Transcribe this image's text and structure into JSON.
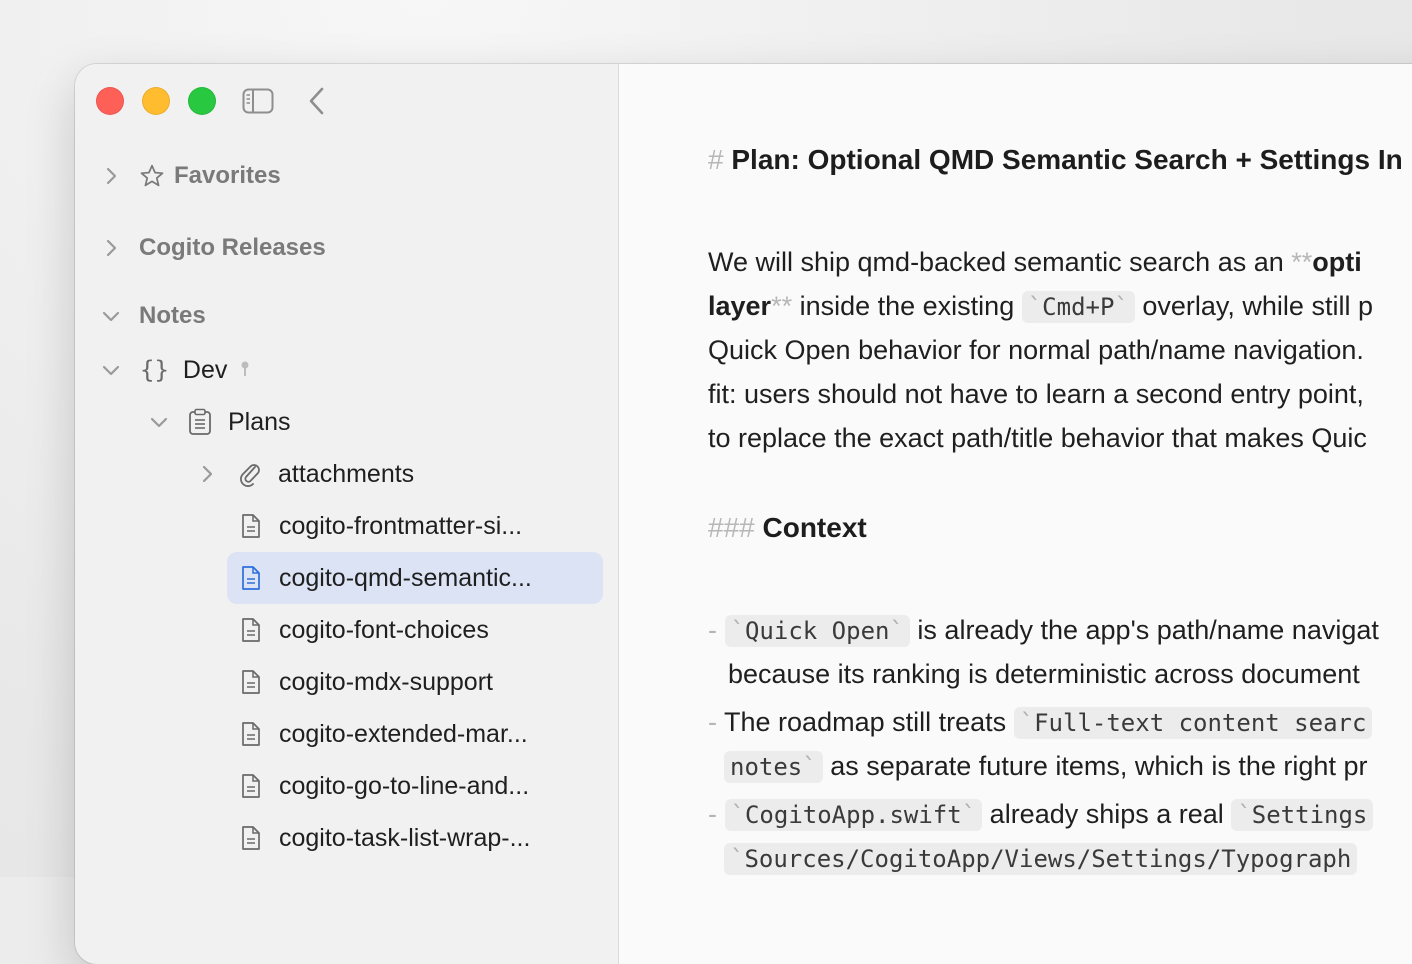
{
  "sidebar": {
    "favorites_label": "Favorites",
    "releases_label": "Cogito Releases",
    "notes_label": "Notes",
    "dev_label": "Dev",
    "plans_label": "Plans",
    "items": [
      {
        "label": "attachments"
      },
      {
        "label": "cogito-frontmatter-si..."
      },
      {
        "label": "cogito-qmd-semantic..."
      },
      {
        "label": "cogito-font-choices"
      },
      {
        "label": "cogito-mdx-support"
      },
      {
        "label": "cogito-extended-mar..."
      },
      {
        "label": "cogito-go-to-line-and..."
      },
      {
        "label": "cogito-task-list-wrap-..."
      }
    ],
    "selected_item": "cogito-qmd-semantic..."
  },
  "doc": {
    "h1_marker": "#",
    "h1_text": "Plan: Optional QMD Semantic Search + Settings In",
    "para": {
      "l1_a": "We will ship qmd-backed semantic search as an ",
      "l1_stars": "**",
      "l1_bold": "opti",
      "l2_bold": "layer",
      "l2_stars": "**",
      "l2_a": " inside the existing ",
      "l2_code": "Cmd+P",
      "l2_b": " overlay, while still p",
      "l3": "Quick Open behavior for normal path/name navigation.",
      "l4": "fit: users should not have to learn a second entry point,",
      "l5": "to replace the exact path/title behavior that makes Quic"
    },
    "h3_marker": "###",
    "h3_text": "Context",
    "bullets": {
      "dash": "-",
      "b1_code": "Quick Open",
      "b1_a": " is already the app's path/name navigat",
      "b1_l2": "because its ranking is deterministic across document",
      "b2_a": "The roadmap still treats ",
      "b2_code": "Full-text content searc",
      "b2_l2_code": "notes",
      "b2_l2_a": " as separate future items, which is the right pr",
      "b3_code": "CogitoApp.swift",
      "b3_a": " already ships a real ",
      "b3_code2": "Settings",
      "b3_l2_code": "Sources/CogitoApp/Views/Settings/Typograph"
    },
    "backtick": "`"
  },
  "colors": {
    "close": "#fe5f57",
    "minimize": "#febc2e",
    "maximize": "#28c840",
    "selection": "#dbe3f4",
    "accent": "#2f6fdd"
  }
}
